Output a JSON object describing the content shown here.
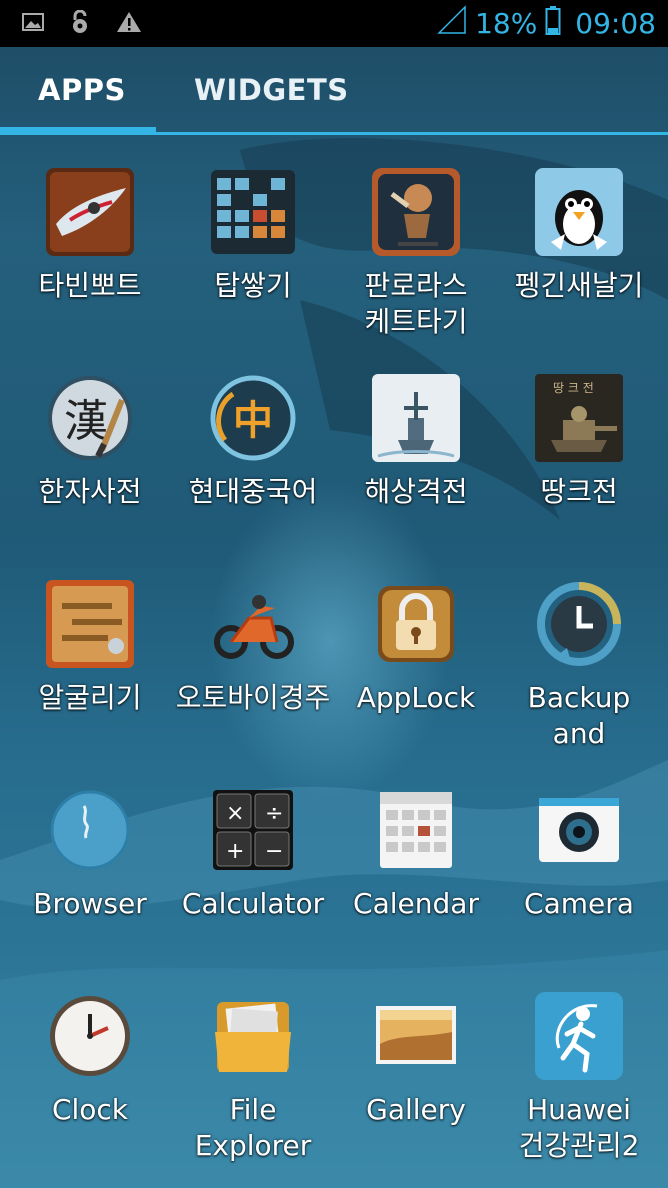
{
  "status_bar": {
    "icons_left": [
      "image-icon",
      "unlock-icon",
      "warning-icon"
    ],
    "battery_percent": "18%",
    "time": "09:08",
    "accent_color": "#33b5e5"
  },
  "tabs": [
    {
      "label": "APPS",
      "selected": true
    },
    {
      "label": "WIDGETS",
      "selected": false
    }
  ],
  "apps": [
    {
      "label": "타빈뽀트",
      "icon": "speedboat-icon"
    },
    {
      "label": "탑쌓기",
      "icon": "block-stack-icon"
    },
    {
      "label": "판로라스 케트타기",
      "icon": "skater-icon"
    },
    {
      "label": "펭긴새날기",
      "icon": "penguin-icon"
    },
    {
      "label": "한자사전",
      "icon": "hanja-dictionary-icon"
    },
    {
      "label": "현대중국어",
      "icon": "chinese-character-icon"
    },
    {
      "label": "해상격전",
      "icon": "battleship-icon"
    },
    {
      "label": "땅크전",
      "icon": "tank-icon"
    },
    {
      "label": "알굴리기",
      "icon": "maze-ball-icon"
    },
    {
      "label": "오토바이경주",
      "icon": "motorbike-icon"
    },
    {
      "label": "AppLock",
      "icon": "padlock-icon"
    },
    {
      "label": "Backup and",
      "icon": "backup-clock-icon"
    },
    {
      "label": "Browser",
      "icon": "globe-icon"
    },
    {
      "label": "Calculator",
      "icon": "calculator-icon"
    },
    {
      "label": "Calendar",
      "icon": "calendar-icon"
    },
    {
      "label": "Camera",
      "icon": "camera-icon"
    },
    {
      "label": "Clock",
      "icon": "clock-icon"
    },
    {
      "label": "File Explorer",
      "icon": "folder-icon"
    },
    {
      "label": "Gallery",
      "icon": "gallery-icon"
    },
    {
      "label": "Huawei 건강관리2",
      "icon": "runner-icon"
    }
  ]
}
